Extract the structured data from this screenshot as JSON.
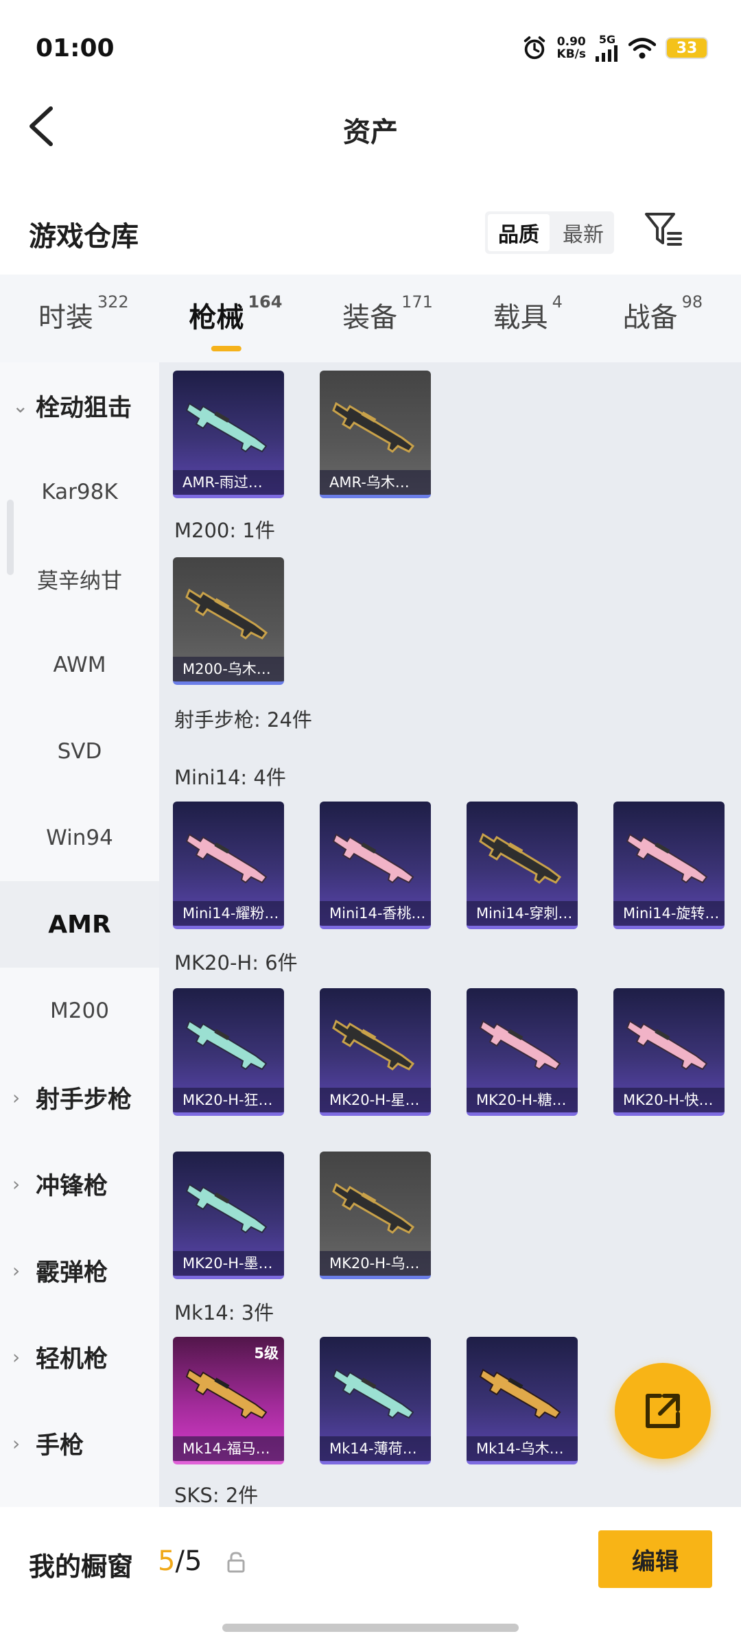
{
  "status_bar": {
    "time": "01:00",
    "net_speed_value": "0.90",
    "net_speed_unit": "KB/s",
    "signal": "5G",
    "battery": "33"
  },
  "header": {
    "title": "资产"
  },
  "warehouse": {
    "title": "游戏仓库",
    "sort_options": [
      "品质",
      "最新"
    ],
    "sort_selected": "品质"
  },
  "tabs": [
    {
      "label": "时装",
      "count": "322"
    },
    {
      "label": "枪械",
      "count": "164"
    },
    {
      "label": "装备",
      "count": "171"
    },
    {
      "label": "载具",
      "count": "4"
    },
    {
      "label": "战备",
      "count": "98"
    }
  ],
  "sidebar": {
    "items": [
      {
        "label": "栓动狙击",
        "type": "group-open"
      },
      {
        "label": "Kar98K",
        "type": "item"
      },
      {
        "label": "莫辛纳甘",
        "type": "item"
      },
      {
        "label": "AWM",
        "type": "item"
      },
      {
        "label": "SVD",
        "type": "item"
      },
      {
        "label": "Win94",
        "type": "item"
      },
      {
        "label": "AMR",
        "type": "item-active"
      },
      {
        "label": "M200",
        "type": "item"
      },
      {
        "label": "射手步枪",
        "type": "group"
      },
      {
        "label": "冲锋枪",
        "type": "group"
      },
      {
        "label": "霰弹枪",
        "type": "group"
      },
      {
        "label": "轻机枪",
        "type": "group"
      },
      {
        "label": "手枪",
        "type": "group"
      }
    ]
  },
  "content": {
    "amr_cards": [
      {
        "name": "AMR-雨过…",
        "style": "purple"
      },
      {
        "name": "AMR-乌木…",
        "style": "gray"
      }
    ],
    "m200_title": "M200: 1件",
    "m200_cards": [
      {
        "name": "M200-乌木…",
        "style": "gray"
      }
    ],
    "marksman_title": "射手步枪: 24件",
    "mini14_title": "Mini14: 4件",
    "mini14_cards": [
      {
        "name": "Mini14-耀粉…",
        "style": "purple"
      },
      {
        "name": "Mini14-香桃…",
        "style": "purple"
      },
      {
        "name": "Mini14-穿刺…",
        "style": "purple"
      },
      {
        "name": "Mini14-旋转…",
        "style": "purple"
      }
    ],
    "mk20_title": "MK20-H: 6件",
    "mk20_cards_row1": [
      {
        "name": "MK20-H-狂…",
        "style": "purple"
      },
      {
        "name": "MK20-H-星…",
        "style": "purple"
      },
      {
        "name": "MK20-H-糖…",
        "style": "purple"
      },
      {
        "name": "MK20-H-快…",
        "style": "purple"
      }
    ],
    "mk20_cards_row2": [
      {
        "name": "MK20-H-墨…",
        "style": "purple"
      },
      {
        "name": "MK20-H-乌…",
        "style": "gray"
      }
    ],
    "mk14_title": "Mk14: 3件",
    "mk14_cards": [
      {
        "name": "Mk14-福马…",
        "style": "pink",
        "level": "5级"
      },
      {
        "name": "Mk14-薄荷…",
        "style": "purple"
      },
      {
        "name": "Mk14-乌木…",
        "style": "purple"
      }
    ],
    "sks_title": "SKS: 2件"
  },
  "bottom_bar": {
    "title": "我的橱窗",
    "count_current": "5",
    "count_sep": "/",
    "count_max": "5",
    "edit_label": "编辑"
  },
  "colors": {
    "accent": "#f8b416",
    "card_purple": "#3b3375",
    "card_gray": "#575757",
    "card_pink": "#a22b9a"
  },
  "icons": [
    "back-arrow-icon",
    "filter-icon",
    "alarm-icon",
    "wifi-icon",
    "lock-icon",
    "share-icon",
    "gun-icon"
  ]
}
